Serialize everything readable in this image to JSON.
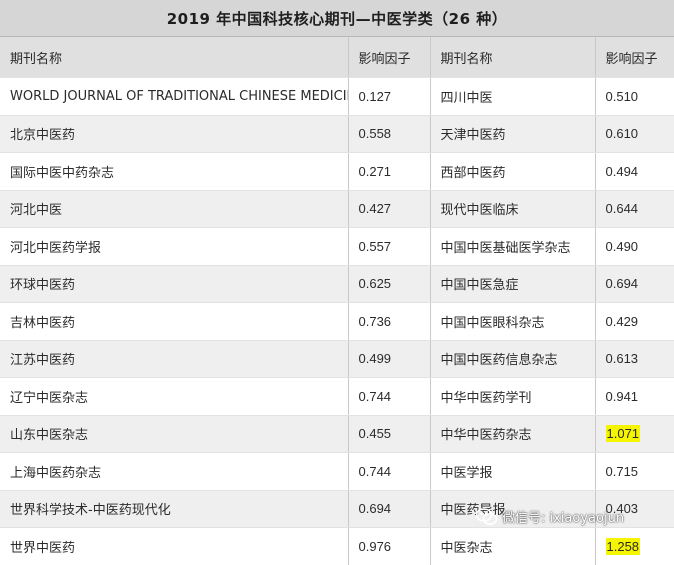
{
  "title": "2019 年中国科技核心期刊—中医学类（26 种）",
  "headers": [
    "期刊名称",
    "影响因子",
    "期刊名称",
    "影响因子"
  ],
  "rows": [
    {
      "name_left": "WORLD JOURNAL OF TRADITIONAL CHINESE MEDICINE",
      "if_left": "0.127",
      "name_right": "四川中医",
      "if_right": "0.510"
    },
    {
      "name_left": "北京中医药",
      "if_left": "0.558",
      "name_right": "天津中医药",
      "if_right": "0.610"
    },
    {
      "name_left": "国际中医中药杂志",
      "if_left": "0.271",
      "name_right": "西部中医药",
      "if_right": "0.494"
    },
    {
      "name_left": "河北中医",
      "if_left": "0.427",
      "name_right": "现代中医临床",
      "if_right": "0.644"
    },
    {
      "name_left": "河北中医药学报",
      "if_left": "0.557",
      "name_right": "中国中医基础医学杂志",
      "if_right": "0.490"
    },
    {
      "name_left": "环球中医药",
      "if_left": "0.625",
      "name_right": "中国中医急症",
      "if_right": "0.694"
    },
    {
      "name_left": "吉林中医药",
      "if_left": "0.736",
      "name_right": "中国中医眼科杂志",
      "if_right": "0.429"
    },
    {
      "name_left": "江苏中医药",
      "if_left": "0.499",
      "name_right": "中国中医药信息杂志",
      "if_right": "0.613"
    },
    {
      "name_left": "辽宁中医杂志",
      "if_left": "0.744",
      "name_right": "中华中医药学刊",
      "if_right": "0.941"
    },
    {
      "name_left": "山东中医杂志",
      "if_left": "0.455",
      "name_right": "中华中医药杂志",
      "if_right": "1.071"
    },
    {
      "name_left": "上海中医药杂志",
      "if_left": "0.744",
      "name_right": "中医学报",
      "if_right": "0.715"
    },
    {
      "name_left": "世界科学技术-中医药现代化",
      "if_left": "0.694",
      "name_right": "中医药导报",
      "if_right": "0.403"
    },
    {
      "name_left": "世界中医药",
      "if_left": "0.976",
      "name_right": "中医杂志",
      "if_right": "1.258"
    }
  ],
  "highlight_color": "#f5f500",
  "watermark": {
    "text": "微信号: ixiaoyaojun",
    "icon": "wechat-icon"
  }
}
